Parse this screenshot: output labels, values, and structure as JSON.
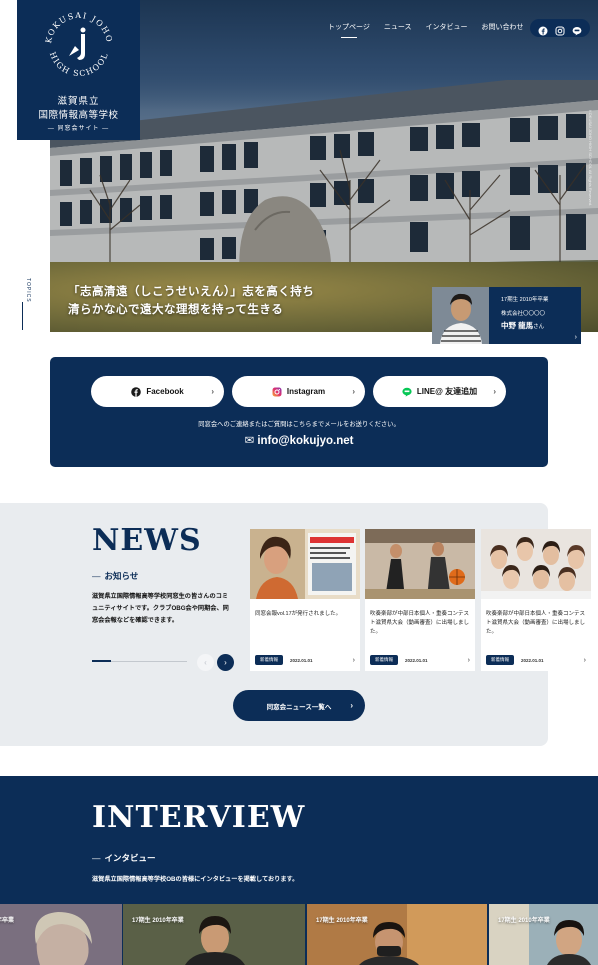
{
  "logo": {
    "seal_text": "KOKUSAI JOHO HIGH SCHOOL",
    "line1": "滋賀県立",
    "line2": "国際情報高等学校",
    "line3": "— 同窓会サイト —"
  },
  "nav": {
    "items": [
      "トップページ",
      "ニュース",
      "インタビュー",
      "お問い合わせ"
    ],
    "active_index": 0
  },
  "hero": {
    "caption_line1": "「志高清遠（しこうせいえん）」志を高く持ち",
    "caption_line2": "清らかな心で遠大な理想を持って生きる",
    "side_text": "TOPICS",
    "copyright": "KOKUSAI JOHO HIGH SCHOOL All Rights Reserved.",
    "person": {
      "graduation": "17期生 2010年卒業",
      "company": "株式会社〇〇〇〇",
      "name": "中野 龍馬",
      "honorific": "さん"
    }
  },
  "contact": {
    "facebook": "Facebook",
    "instagram": "Instagram",
    "line": "LINE@ 友達追加",
    "note": "同窓会へのご連絡またはご質問はこちらまでメールをお送りください。",
    "email": "info@kokujyo.net"
  },
  "news": {
    "title": "NEWS",
    "subtitle": "お知らせ",
    "description": "滋賀県立国際情報高等学校同窓生の皆さんのコミュニティサイトです。クラブOBG会や同期会、同窓会会報などを確認できます。",
    "cards": [
      {
        "text": "同窓会報vol.17が発行されました。",
        "tag": "新着情報",
        "date": "2022.01.01"
      },
      {
        "text": "吹奏楽部が中部日本個人・重奏コンテスト滋賀県大会（動画審査）に出場しました。",
        "tag": "新着情報",
        "date": "2022.01.01"
      },
      {
        "text": "吹奏楽部が中部日本個人・重奏コンテスト滋賀県大会（動画審査）に出場しました。",
        "tag": "新着情報",
        "date": "2022.01.01"
      }
    ],
    "all_button": "同窓会ニュース一覧へ",
    "progress": 0.2
  },
  "interview": {
    "title": "INTERVIEW",
    "subtitle": "インタビュー",
    "description": "滋賀県立国際情報高等学校OBの皆様にインタビューを掲載しております。",
    "cards": [
      "年卒業",
      "17期生 2010年卒業",
      "17期生 2010年卒業",
      "17期生 2010年卒業"
    ]
  },
  "colors": {
    "navy": "#0c2d57",
    "news_bg": "#e9ecef",
    "white": "#ffffff"
  },
  "icons": [
    "facebook-icon",
    "instagram-icon",
    "line-icon",
    "mail-icon",
    "chevron-right-icon",
    "chevron-left-icon"
  ]
}
